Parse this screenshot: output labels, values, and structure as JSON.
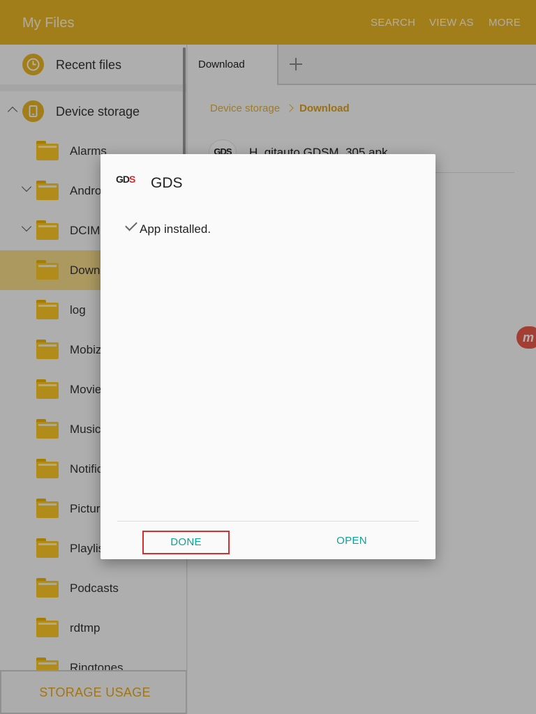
{
  "appbar": {
    "title": "My Files",
    "actions": [
      "SEARCH",
      "VIEW AS",
      "MORE"
    ],
    "color": "#e9b527"
  },
  "sidebar": {
    "recent_label": "Recent files",
    "device_storage_label": "Device storage",
    "folders": [
      "Alarms",
      "Android",
      "DCIM",
      "Download",
      "log",
      "Mobizen",
      "Movies",
      "Music",
      "Notifications",
      "Pictures",
      "Playlists",
      "Podcasts",
      "rdtmp",
      "Ringtones"
    ],
    "selected_folder": "Download",
    "storage_usage_label": "STORAGE USAGE"
  },
  "main": {
    "tab_label": "Download",
    "breadcrumb": [
      "Device storage",
      "Download"
    ],
    "file": {
      "icon_text": "GDS",
      "name": "H_gitauto GDSM_305.apk"
    },
    "float_badge": "m"
  },
  "dialog": {
    "logo": {
      "gd": "GD",
      "s": "S"
    },
    "title": "GDS",
    "message": "App installed.",
    "done_label": "DONE",
    "open_label": "OPEN",
    "button_color": "#11a192"
  }
}
